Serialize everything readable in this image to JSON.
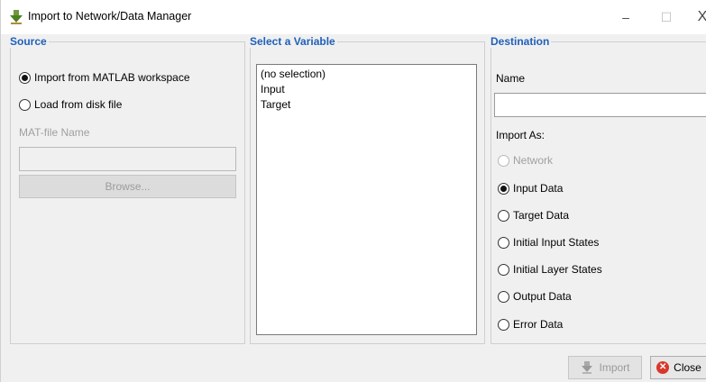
{
  "window": {
    "title": "Import to Network/Data Manager",
    "controls": {
      "minimize": "–",
      "maximize": "☐",
      "close": "X"
    }
  },
  "source": {
    "legend": "Source",
    "options": [
      {
        "label": "Import from MATLAB workspace",
        "checked": true
      },
      {
        "label": "Load from disk file",
        "checked": false
      }
    ],
    "matfile_label": "MAT-file Name",
    "matfile_value": "",
    "browse_label": "Browse..."
  },
  "variable": {
    "legend": "Select a Variable",
    "items": [
      "(no selection)",
      "Input",
      "Target"
    ]
  },
  "destination": {
    "legend": "Destination",
    "name_label": "Name",
    "name_value": "",
    "import_as_label": "Import As:",
    "options": [
      {
        "label": "Network",
        "checked": false,
        "disabled": true
      },
      {
        "label": "Input Data",
        "checked": true,
        "disabled": false
      },
      {
        "label": "Target Data",
        "checked": false,
        "disabled": false
      },
      {
        "label": "Initial Input States",
        "checked": false,
        "disabled": false
      },
      {
        "label": "Initial Layer States",
        "checked": false,
        "disabled": false
      },
      {
        "label": "Output Data",
        "checked": false,
        "disabled": false
      },
      {
        "label": "Error Data",
        "checked": false,
        "disabled": false
      }
    ]
  },
  "footer": {
    "import_label": "Import",
    "close_label": "Close"
  },
  "icons": {
    "app": "import-arrow-icon",
    "close": "close-circle-icon"
  },
  "colors": {
    "legend": "#2060b8",
    "close_icon": "#d7382c"
  }
}
